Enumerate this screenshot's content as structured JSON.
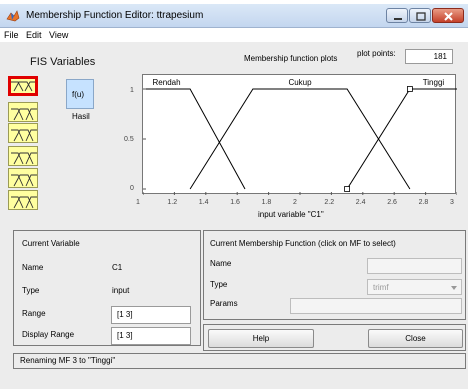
{
  "window": {
    "title": "Membership Function Editor: ttrapesium",
    "controls": {
      "minimize": "minimize",
      "maximize": "maximize",
      "close": "close"
    }
  },
  "menu": {
    "items": [
      "File",
      "Edit",
      "View"
    ]
  },
  "fis_panel": {
    "title": "FIS Variables",
    "output_box_label": "f(u)",
    "output_name": "Hasil"
  },
  "plot": {
    "header_label": "Membership function plots",
    "plot_points_label": "plot points:",
    "plot_points_value": "181",
    "x_axis_label": "input variable \"C1\"",
    "y_ticks": [
      "1",
      "0.5",
      "0"
    ],
    "x_ticks": [
      "1",
      "1.2",
      "1.4",
      "1.6",
      "1.8",
      "2",
      "2.2",
      "2.4",
      "2.6",
      "2.8",
      "3"
    ],
    "mf_labels": [
      "Rendah",
      "Cukup",
      "Tinggi"
    ]
  },
  "chart_data": {
    "type": "line",
    "xlabel": "input variable \"C1\"",
    "ylabel": "",
    "xlim": [
      1,
      3
    ],
    "ylim": [
      0,
      1
    ],
    "series": [
      {
        "name": "Rendah",
        "x": [
          1.0,
          1.3,
          1.65
        ],
        "y": [
          1,
          1,
          0
        ]
      },
      {
        "name": "Cukup",
        "x": [
          1.3,
          1.7,
          2.3,
          2.7
        ],
        "y": [
          0,
          1,
          1,
          0
        ]
      },
      {
        "name": "Tinggi",
        "x": [
          2.3,
          2.7,
          3.0
        ],
        "y": [
          0,
          1,
          1
        ]
      }
    ],
    "colors": {
      "Rendah": "#000000",
      "Cukup": "#000000",
      "Tinggi": "#000000"
    }
  },
  "current_variable": {
    "title": "Current Variable",
    "name_label": "Name",
    "name_value": "C1",
    "type_label": "Type",
    "type_value": "input",
    "range_label": "Range",
    "range_value": "[1 3]",
    "display_range_label": "Display Range",
    "display_range_value": "[1 3]"
  },
  "current_mf": {
    "title": "Current Membership Function (click on MF to select)",
    "name_label": "Name",
    "name_value": "",
    "type_label": "Type",
    "type_value": "trimf",
    "params_label": "Params",
    "params_value": ""
  },
  "buttons": {
    "help": "Help",
    "close": "Close"
  },
  "status": "Renaming MF 3 to \"Tinggi\"",
  "colors": {
    "accent_selected": "#e00000",
    "variable_icon": "#ffffa0",
    "output_box": "#c6e2ff"
  }
}
